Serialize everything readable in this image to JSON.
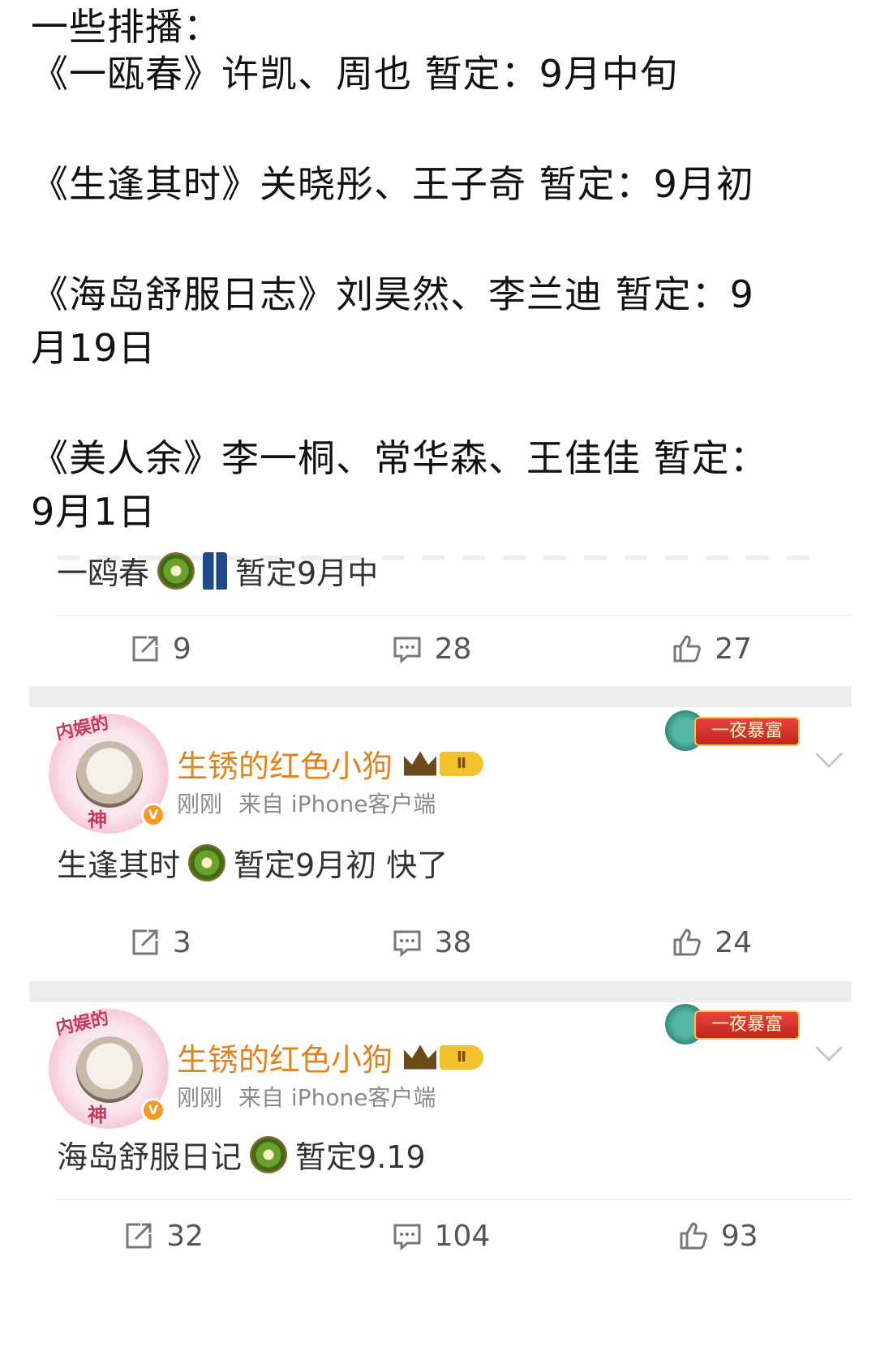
{
  "top_post": {
    "lines": [
      "一些排播：",
      "《一瓯春》许凯、周也 暂定：9月中旬",
      "《生逢其时》关晓彤、王子奇 暂定：9月初",
      "《海岛舒服日志》刘昊然、李兰迪 暂定：9",
      "月19日",
      "《美人余》李一桐、常华森、王佳佳 暂定：",
      "9月1日"
    ]
  },
  "posts": [
    {
      "text_prefix": "一鸥春",
      "text_suffix": "暂定9月中",
      "emojis": [
        "kiwi-emoji",
        "jeans-emoji"
      ],
      "actions": {
        "repost": "9",
        "comment": "28",
        "like": "27"
      }
    },
    {
      "username": "生锈的红色小狗",
      "level": "Ⅱ",
      "time": "刚刚",
      "source": "来自 iPhone客户端",
      "avatar_tag_top": "内娱的",
      "avatar_tag_bottom": "神",
      "badge_text": "一夜暴富",
      "text_prefix": "生逢其时",
      "text_suffix": "暂定9月初 快了",
      "emojis": [
        "kiwi-emoji"
      ],
      "actions": {
        "repost": "3",
        "comment": "38",
        "like": "24"
      }
    },
    {
      "username": "生锈的红色小狗",
      "level": "Ⅱ",
      "time": "刚刚",
      "source": "来自 iPhone客户端",
      "avatar_tag_top": "内娱的",
      "avatar_tag_bottom": "神",
      "badge_text": "一夜暴富",
      "text_prefix": "海岛舒服日记",
      "text_suffix": "暂定9.19",
      "emojis": [
        "kiwi-emoji"
      ],
      "actions": {
        "repost": "32",
        "comment": "104",
        "like": "93"
      }
    }
  ],
  "colors": {
    "username": "#e0821e",
    "meta": "#8a8a8a",
    "separator": "#ececec",
    "verify_badge": "#f59a23"
  }
}
